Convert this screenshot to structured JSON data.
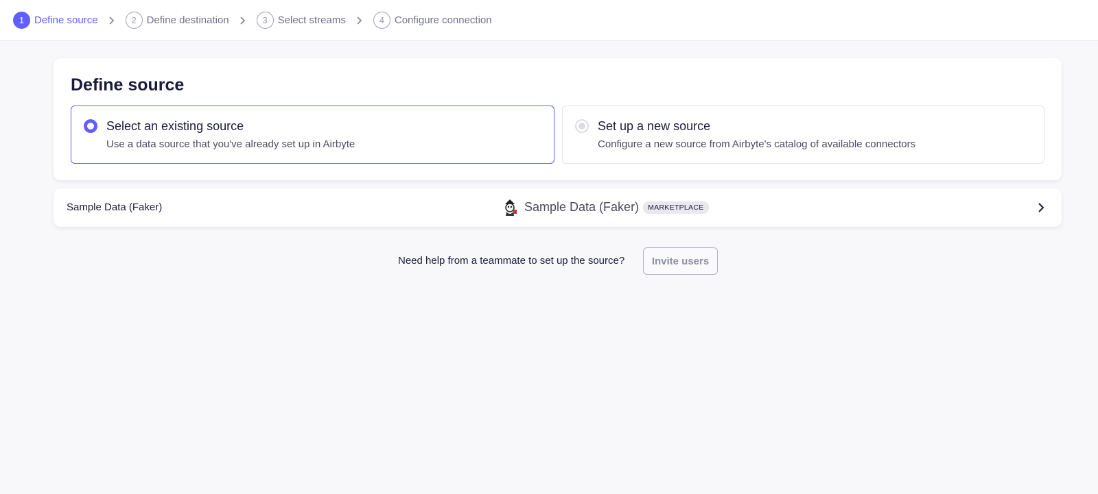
{
  "stepper": {
    "steps": [
      {
        "number": "1",
        "label": "Define source",
        "active": true
      },
      {
        "number": "2",
        "label": "Define destination",
        "active": false
      },
      {
        "number": "3",
        "label": "Select streams",
        "active": false
      },
      {
        "number": "4",
        "label": "Configure connection",
        "active": false
      }
    ],
    "active_color": "#615eff"
  },
  "define_source": {
    "title": "Define source",
    "options": [
      {
        "title": "Select an existing source",
        "description": "Use a data source that you've already set up in Airbyte",
        "selected": true
      },
      {
        "title": "Set up a new source",
        "description": "Configure a new source from Airbyte's catalog of available connectors",
        "selected": false
      }
    ]
  },
  "sources": [
    {
      "name": "Sample Data (Faker)",
      "connector": "Sample Data (Faker)",
      "badge": "MARKETPLACE",
      "icon": "faker-icon"
    }
  ],
  "help": {
    "text": "Need help from a teammate to set up the source?",
    "invite_label": "Invite users"
  }
}
